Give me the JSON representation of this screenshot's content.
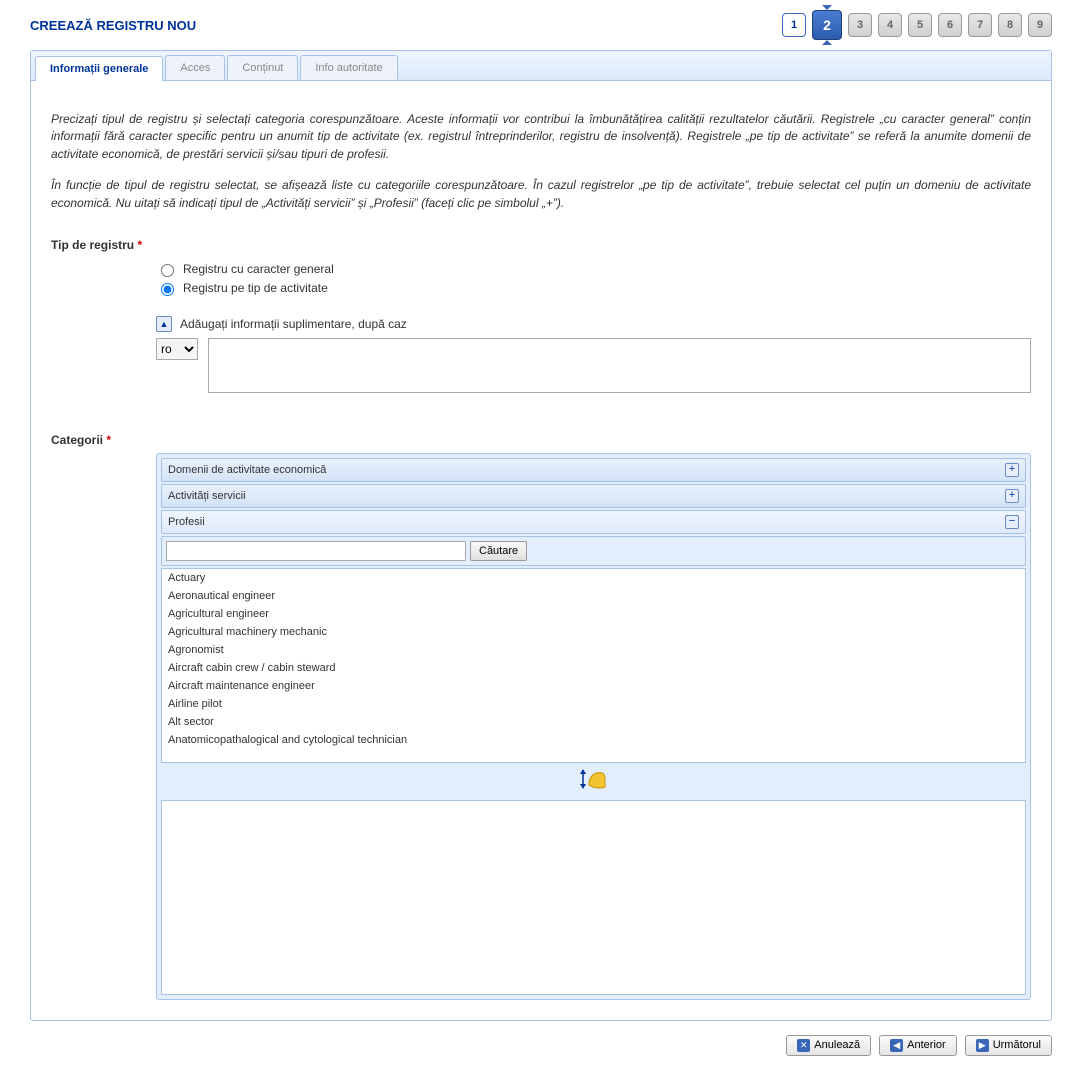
{
  "title": "CREEAZĂ REGISTRU NOU",
  "steps": [
    "1",
    "2",
    "3",
    "4",
    "5",
    "6",
    "7",
    "8",
    "9"
  ],
  "active_step": 2,
  "tabs": [
    {
      "label": "Informații generale",
      "active": true
    },
    {
      "label": "Acces",
      "active": false
    },
    {
      "label": "Conținut",
      "active": false
    },
    {
      "label": "Info autoritate",
      "active": false
    }
  ],
  "intro1": "Precizați tipul de registru și selectați categoria corespunzătoare. Aceste informații vor contribui la îmbunătățirea calității rezultatelor căutării. Registrele „cu caracter general” conțin informații fără caracter specific pentru un anumit tip de activitate (ex. registrul întreprinderilor, registru de insolvență). Registrele „pe tip de activitate” se referă la anumite domenii de activitate economică, de prestări servicii și/sau tipuri de profesii.",
  "intro2": "În funcție de tipul de registru selectat, se afișează liste cu categoriile corespunzătoare. În cazul registrelor „pe tip de activitate”, trebuie selectat cel puțin un domeniu de activitate economică. Nu uitați să indicați tipul de „Activități servicii” și „Profesii” (faceți clic pe simbolul „+”).",
  "type_label": "Tip de registru",
  "radio_general": "Registru cu caracter general",
  "radio_activity": "Registru pe tip de activitate",
  "supp_label": "Adăugați informații suplimentare, după caz",
  "lang_value": "ro",
  "categories_label": "Categorii",
  "cat_economic": "Domenii de activitate economică",
  "cat_services": "Activități servicii",
  "cat_professions": "Profesii",
  "search_btn": "Căutare",
  "professions": [
    "Actuary",
    "Aeronautical engineer",
    "Agricultural engineer",
    "Agricultural machinery mechanic",
    "Agronomist",
    "Aircraft cabin crew / cabin steward",
    "Aircraft maintenance engineer",
    "Airline pilot",
    "Alt sector",
    "Anatomicopathalogical and cytological technician"
  ],
  "btn_cancel": "Anulează",
  "btn_prev": "Anterior",
  "btn_next": "Următorul"
}
